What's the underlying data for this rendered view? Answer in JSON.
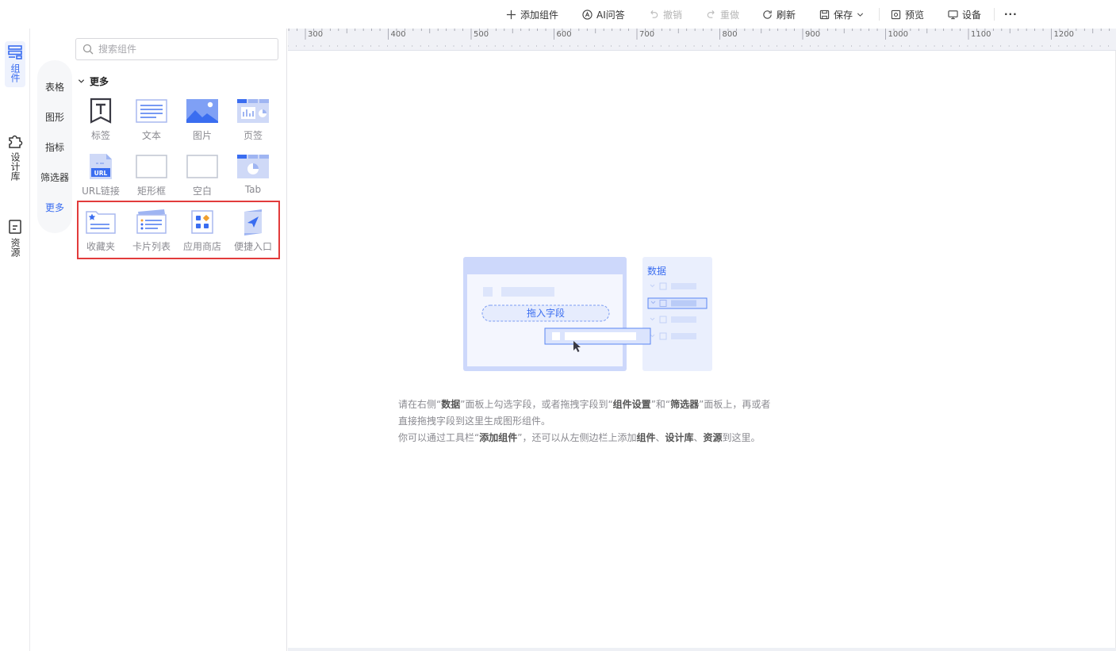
{
  "toolbar": {
    "add_component": "添加组件",
    "ai_qa": "AI问答",
    "undo": "撤销",
    "redo": "重做",
    "refresh": "刷新",
    "save": "保存",
    "preview": "预览",
    "device": "设备",
    "more": "···"
  },
  "rail": {
    "items": [
      {
        "label": "组件",
        "icon": "components-icon",
        "active": true
      },
      {
        "label": "设计库",
        "icon": "puzzle-icon",
        "active": false
      },
      {
        "label": "资源",
        "icon": "resource-icon",
        "active": false
      }
    ]
  },
  "panel": {
    "search_placeholder": "搜索组件",
    "subnav": [
      "表格",
      "图形",
      "指标",
      "筛选器",
      "更多"
    ],
    "subnav_active": "更多",
    "group_title": "更多",
    "components": [
      {
        "label": "标签",
        "icon": "label-icon"
      },
      {
        "label": "文本",
        "icon": "text-icon"
      },
      {
        "label": "图片",
        "icon": "image-icon"
      },
      {
        "label": "页签",
        "icon": "tab-page-icon"
      },
      {
        "label": "URL链接",
        "icon": "url-link-icon"
      },
      {
        "label": "矩形框",
        "icon": "rectangle-icon"
      },
      {
        "label": "空白",
        "icon": "blank-icon"
      },
      {
        "label": "Tab",
        "icon": "tab-icon"
      },
      {
        "label": "收藏夹",
        "icon": "favorites-icon"
      },
      {
        "label": "卡片列表",
        "icon": "card-list-icon"
      },
      {
        "label": "应用商店",
        "icon": "app-store-icon"
      },
      {
        "label": "便捷入口",
        "icon": "quick-entry-icon"
      }
    ],
    "url_badge": "URL"
  },
  "ruler": {
    "ticks": [
      "300",
      "400",
      "500",
      "600",
      "700",
      "800",
      "900",
      "1000",
      "1100",
      "1200"
    ]
  },
  "illustration": {
    "data_panel_title": "数据",
    "drop_zone_label": "拖入字段"
  },
  "hint": {
    "l1_a": "请在右侧“",
    "l1_b": "数据",
    "l1_c": "”面板上勾选字段，或者拖拽字段到“",
    "l1_d": "组件设置",
    "l1_e": "”和“",
    "l1_f": "筛选器",
    "l1_g": "”面板上，再或者直接拖拽字段到这里生成图形组件。",
    "l2_a": "你可以通过工具栏“",
    "l2_b": "添加组件",
    "l2_c": "”，还可以从左侧边栏上添加",
    "l2_d": "组件",
    "l2_e": "、",
    "l2_f": "设计库",
    "l2_g": "、",
    "l2_h": "资源",
    "l2_i": "到这里。"
  },
  "colors": {
    "accent": "#3a6df0",
    "highlight_border": "#e23b3b",
    "icon_blue": "#4a78ef",
    "icon_light": "#c8d4f7"
  }
}
